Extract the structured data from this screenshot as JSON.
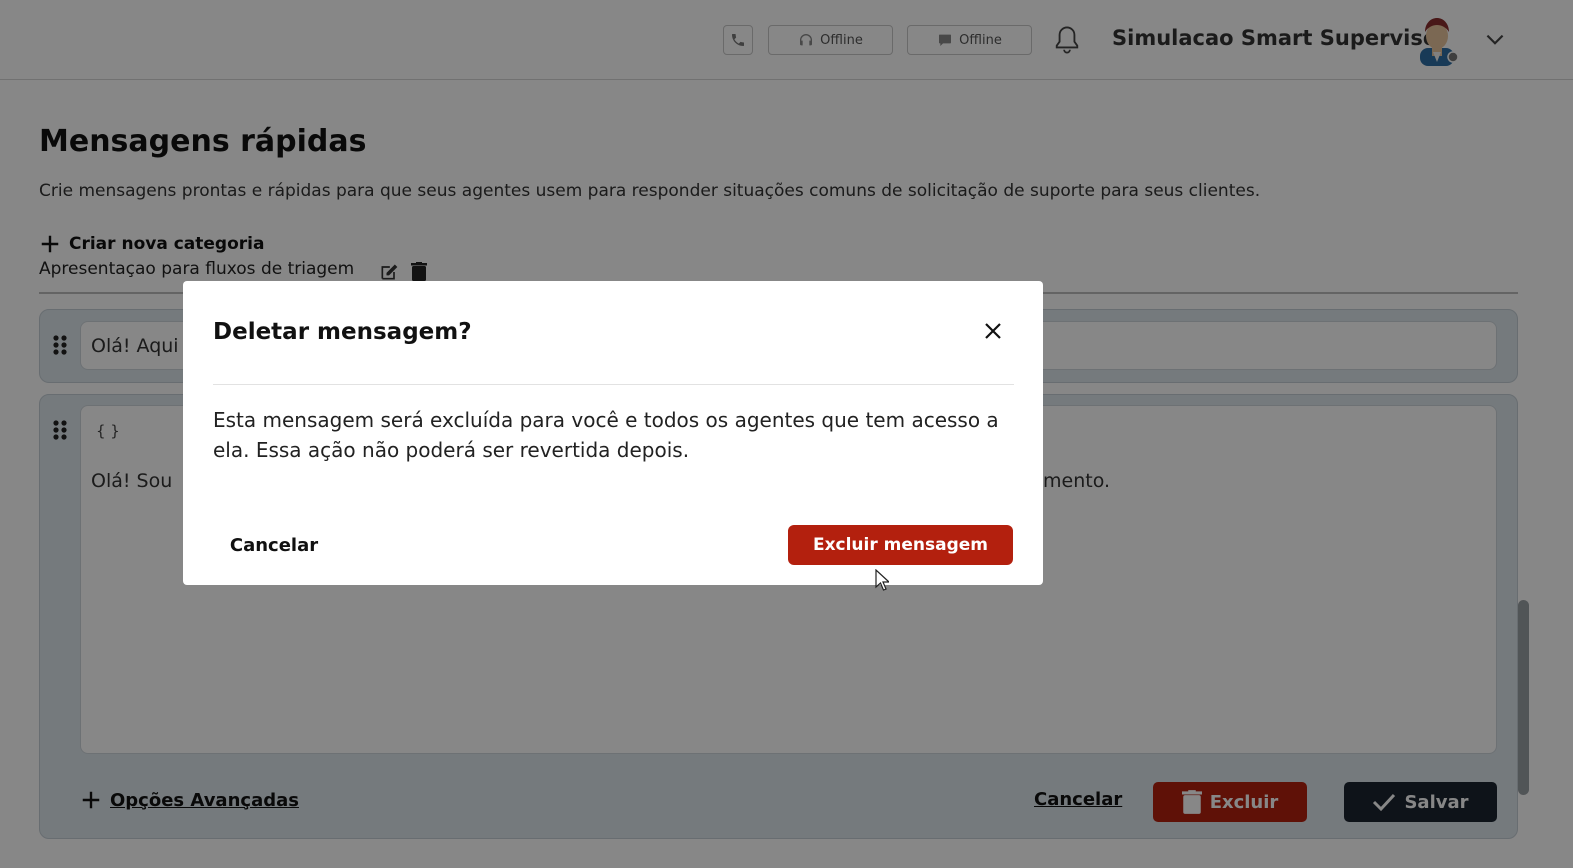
{
  "header": {
    "status_voice": "Offline",
    "status_chat": "Offline",
    "user_name": "Simulacao Smart Supervisor"
  },
  "page": {
    "title": "Mensagens rápidas",
    "description": "Crie mensagens prontas e rápidas para que seus agentes usem para responder situações comuns de solicitação de suporte para seus clientes.",
    "new_category_label": "Criar nova categoria",
    "category_name": "Apresentaçao para fluxos de triagem"
  },
  "messages": [
    {
      "text": "Olá! Aqui"
    },
    {
      "braces": "{ }",
      "text_start": "Olá! Sou",
      "text_end": "mento."
    }
  ],
  "editor": {
    "advanced_options": "Opções Avançadas",
    "cancel": "Cancelar",
    "delete": "Excluir",
    "save": "Salvar"
  },
  "modal": {
    "title": "Deletar mensagem?",
    "body": "Esta mensagem será excluída para você e todos os agentes que tem acesso a ela. Essa ação não poderá ser revertida depois.",
    "cancel": "Cancelar",
    "confirm": "Excluir mensagem"
  },
  "colors": {
    "danger": "#b3200e",
    "primary_dark": "#1b2530",
    "card_bg": "#dde6ec"
  }
}
